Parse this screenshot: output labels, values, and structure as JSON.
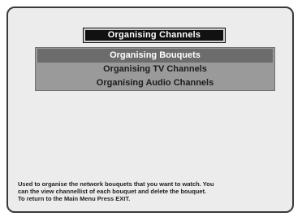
{
  "screen": {
    "title": "Organising Channels",
    "menu": {
      "items": [
        {
          "label": "Organising Bouquets",
          "selected": true
        },
        {
          "label": "Organising TV Channels",
          "selected": false
        },
        {
          "label": "Organising Audio Channels",
          "selected": false
        }
      ]
    },
    "help": {
      "lines": [
        "Used to organise the network bouquets that you want to watch.   You",
        "can the view channellist of each bouquet and delete the bouquet.",
        "To return to the Main Menu Press EXIT."
      ]
    }
  },
  "colors": {
    "screen_background": "#ececec",
    "title_background": "#111111",
    "menu_background": "#9a9a9a",
    "selected_item_background": "#6c6c6c"
  }
}
